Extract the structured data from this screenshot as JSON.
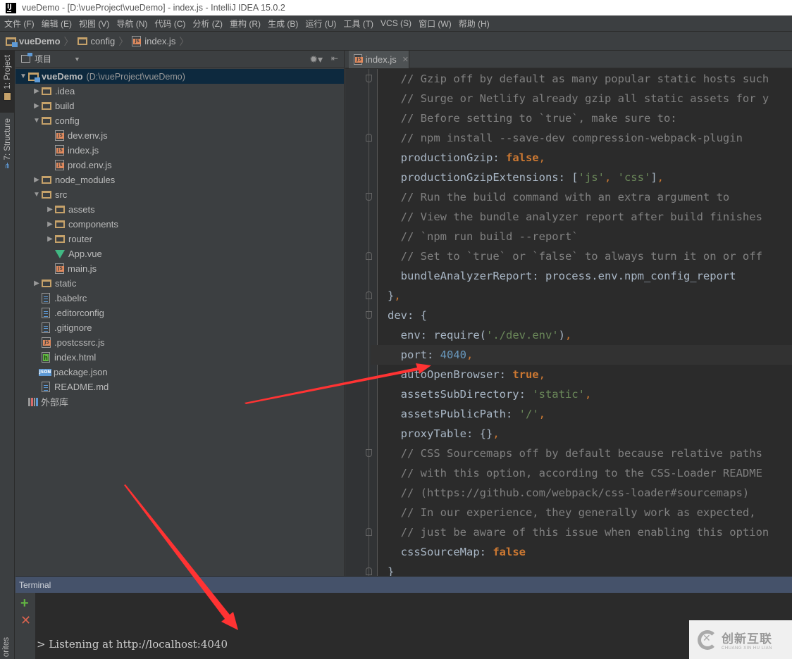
{
  "window": {
    "app_icon_label": "IJ",
    "title": "vueDemo - [D:\\vueProject\\vueDemo] - index.js - IntelliJ IDEA 15.0.2"
  },
  "menu": [
    {
      "label": "文件 (F)"
    },
    {
      "label": "编辑 (E)"
    },
    {
      "label": "视图 (V)"
    },
    {
      "label": "导航 (N)"
    },
    {
      "label": "代码 (C)"
    },
    {
      "label": "分析 (Z)"
    },
    {
      "label": "重构 (R)"
    },
    {
      "label": "生成 (B)"
    },
    {
      "label": "运行 (U)"
    },
    {
      "label": "工具 (T)"
    },
    {
      "label": "VCS (S)"
    },
    {
      "label": "窗口 (W)"
    },
    {
      "label": "帮助 (H)"
    }
  ],
  "breadcrumb": [
    {
      "label": "vueDemo",
      "icon": "project-folder-icon"
    },
    {
      "label": "config",
      "icon": "folder-icon"
    },
    {
      "label": "index.js",
      "icon": "js-file-icon"
    }
  ],
  "tool_stripe": {
    "project_tab": "1: Project",
    "structure_tab": "7: Structure",
    "favorites_tab": "orites"
  },
  "project_panel": {
    "view_label": "项目",
    "tree": [
      {
        "label": "vueDemo",
        "hint": "(D:\\vueProject\\vueDemo)",
        "icon": "project-folder-icon",
        "depth": 0,
        "arrow": "expanded",
        "selected": true
      },
      {
        "label": ".idea",
        "icon": "folder-icon",
        "depth": 1,
        "arrow": "collapsed"
      },
      {
        "label": "build",
        "icon": "folder-icon",
        "depth": 1,
        "arrow": "collapsed"
      },
      {
        "label": "config",
        "icon": "folder-icon",
        "depth": 1,
        "arrow": "expanded"
      },
      {
        "label": "dev.env.js",
        "icon": "js-file-icon",
        "depth": 2,
        "arrow": "none"
      },
      {
        "label": "index.js",
        "icon": "js-file-icon",
        "depth": 2,
        "arrow": "none"
      },
      {
        "label": "prod.env.js",
        "icon": "js-file-icon",
        "depth": 2,
        "arrow": "none"
      },
      {
        "label": "node_modules",
        "icon": "folder-icon",
        "depth": 1,
        "arrow": "collapsed"
      },
      {
        "label": "src",
        "icon": "folder-icon",
        "depth": 1,
        "arrow": "expanded"
      },
      {
        "label": "assets",
        "icon": "folder-icon",
        "depth": 2,
        "arrow": "collapsed"
      },
      {
        "label": "components",
        "icon": "folder-icon",
        "depth": 2,
        "arrow": "collapsed"
      },
      {
        "label": "router",
        "icon": "folder-icon",
        "depth": 2,
        "arrow": "collapsed"
      },
      {
        "label": "App.vue",
        "icon": "vue-icon",
        "depth": 2,
        "arrow": "none"
      },
      {
        "label": "main.js",
        "icon": "js-file-icon",
        "depth": 2,
        "arrow": "none"
      },
      {
        "label": "static",
        "icon": "folder-icon",
        "depth": 1,
        "arrow": "collapsed"
      },
      {
        "label": ".babelrc",
        "icon": "text-file-icon",
        "depth": 1,
        "arrow": "none"
      },
      {
        "label": ".editorconfig",
        "icon": "text-file-icon",
        "depth": 1,
        "arrow": "none"
      },
      {
        "label": ".gitignore",
        "icon": "text-file-icon",
        "depth": 1,
        "arrow": "none"
      },
      {
        "label": ".postcssrc.js",
        "icon": "js-file-icon",
        "depth": 1,
        "arrow": "none"
      },
      {
        "label": "index.html",
        "icon": "html-file-icon",
        "depth": 1,
        "arrow": "none"
      },
      {
        "label": "package.json",
        "icon": "json-file-icon",
        "depth": 1,
        "arrow": "none"
      },
      {
        "label": "README.md",
        "icon": "text-file-icon",
        "depth": 1,
        "arrow": "none"
      },
      {
        "label": "外部库",
        "icon": "library-icon",
        "depth": 0,
        "arrow": "none"
      }
    ]
  },
  "editor": {
    "tab_label": "index.js",
    "lines": [
      {
        "indent": "  ",
        "tokens": [
          {
            "t": "// Gzip off by default as many popular static hosts such",
            "c": "comment"
          }
        ],
        "fold": "start"
      },
      {
        "indent": "  ",
        "tokens": [
          {
            "t": "// Surge or Netlify already gzip all static assets for y",
            "c": "comment"
          }
        ]
      },
      {
        "indent": "  ",
        "tokens": [
          {
            "t": "// Before setting to `true`, make sure to:",
            "c": "comment"
          }
        ]
      },
      {
        "indent": "  ",
        "tokens": [
          {
            "t": "// npm install --save-dev compression-webpack-plugin",
            "c": "comment"
          }
        ],
        "fold": "end"
      },
      {
        "indent": "  ",
        "tokens": [
          {
            "t": "productionGzip: ",
            "c": "plain"
          },
          {
            "t": "false",
            "c": "kw"
          },
          {
            "t": ",",
            "c": "punc"
          }
        ]
      },
      {
        "indent": "  ",
        "tokens": [
          {
            "t": "productionGzipExtensions: [",
            "c": "plain"
          },
          {
            "t": "'js'",
            "c": "str"
          },
          {
            "t": ", ",
            "c": "punc"
          },
          {
            "t": "'css'",
            "c": "str"
          },
          {
            "t": "]",
            "c": "plain"
          },
          {
            "t": ",",
            "c": "punc"
          }
        ]
      },
      {
        "indent": "  ",
        "tokens": [
          {
            "t": "// Run the build command with an extra argument to",
            "c": "comment"
          }
        ],
        "fold": "start"
      },
      {
        "indent": "  ",
        "tokens": [
          {
            "t": "// View the bundle analyzer report after build finishes",
            "c": "comment"
          }
        ]
      },
      {
        "indent": "  ",
        "tokens": [
          {
            "t": "// `npm run build --report`",
            "c": "comment"
          }
        ]
      },
      {
        "indent": "  ",
        "tokens": [
          {
            "t": "// Set to `true` or `false` to always turn it on or off",
            "c": "comment"
          }
        ],
        "fold": "end"
      },
      {
        "indent": "  ",
        "tokens": [
          {
            "t": "bundleAnalyzerReport: process.env.npm_config_report",
            "c": "plain"
          }
        ]
      },
      {
        "indent": "",
        "tokens": [
          {
            "t": "}",
            "c": "plain"
          },
          {
            "t": ",",
            "c": "punc"
          }
        ],
        "fold": "end"
      },
      {
        "indent": "",
        "tokens": [
          {
            "t": "dev: {",
            "c": "plain"
          }
        ],
        "fold": "start"
      },
      {
        "indent": "  ",
        "tokens": [
          {
            "t": "env: require(",
            "c": "plain"
          },
          {
            "t": "'./dev.env'",
            "c": "str"
          },
          {
            "t": ")",
            "c": "plain"
          },
          {
            "t": ",",
            "c": "punc"
          }
        ]
      },
      {
        "indent": "  ",
        "tokens": [
          {
            "t": "port: ",
            "c": "plain"
          },
          {
            "t": "4040",
            "c": "num"
          },
          {
            "t": ",",
            "c": "punc"
          }
        ],
        "current": true
      },
      {
        "indent": "  ",
        "tokens": [
          {
            "t": "autoOpenBrowser: ",
            "c": "plain"
          },
          {
            "t": "true",
            "c": "kw"
          },
          {
            "t": ",",
            "c": "punc"
          }
        ]
      },
      {
        "indent": "  ",
        "tokens": [
          {
            "t": "assetsSubDirectory: ",
            "c": "plain"
          },
          {
            "t": "'static'",
            "c": "str"
          },
          {
            "t": ",",
            "c": "punc"
          }
        ]
      },
      {
        "indent": "  ",
        "tokens": [
          {
            "t": "assetsPublicPath: ",
            "c": "plain"
          },
          {
            "t": "'/'",
            "c": "str"
          },
          {
            "t": ",",
            "c": "punc"
          }
        ]
      },
      {
        "indent": "  ",
        "tokens": [
          {
            "t": "proxyTable: {}",
            "c": "plain"
          },
          {
            "t": ",",
            "c": "punc"
          }
        ]
      },
      {
        "indent": "  ",
        "tokens": [
          {
            "t": "// CSS Sourcemaps off by default because relative paths",
            "c": "comment"
          }
        ],
        "fold": "start"
      },
      {
        "indent": "  ",
        "tokens": [
          {
            "t": "// with this option, according to the CSS-Loader README",
            "c": "comment"
          }
        ]
      },
      {
        "indent": "  ",
        "tokens": [
          {
            "t": "// (https://github.com/webpack/css-loader#sourcemaps)",
            "c": "comment"
          }
        ]
      },
      {
        "indent": "  ",
        "tokens": [
          {
            "t": "// In our experience, they generally work as expected,",
            "c": "comment"
          }
        ]
      },
      {
        "indent": "  ",
        "tokens": [
          {
            "t": "// just be aware of this issue when enabling this option",
            "c": "comment"
          }
        ],
        "fold": "end"
      },
      {
        "indent": "  ",
        "tokens": [
          {
            "t": "cssSourceMap: ",
            "c": "plain"
          },
          {
            "t": "false",
            "c": "kw"
          }
        ]
      },
      {
        "indent": "",
        "tokens": [
          {
            "t": "}",
            "c": "plain"
          }
        ],
        "fold": "end"
      }
    ]
  },
  "terminal": {
    "title": "Terminal",
    "add_icon": "+",
    "close_icon": "✕",
    "output": "> Listening at http://localhost:4040"
  },
  "watermark": {
    "name_cn": "创新互联",
    "name_en": "CHUANG XIN HU LIAN"
  },
  "colors": {
    "annotation_arrow": "#ff3333",
    "selection": "#0d293e",
    "terminal_header": "#45526a"
  }
}
